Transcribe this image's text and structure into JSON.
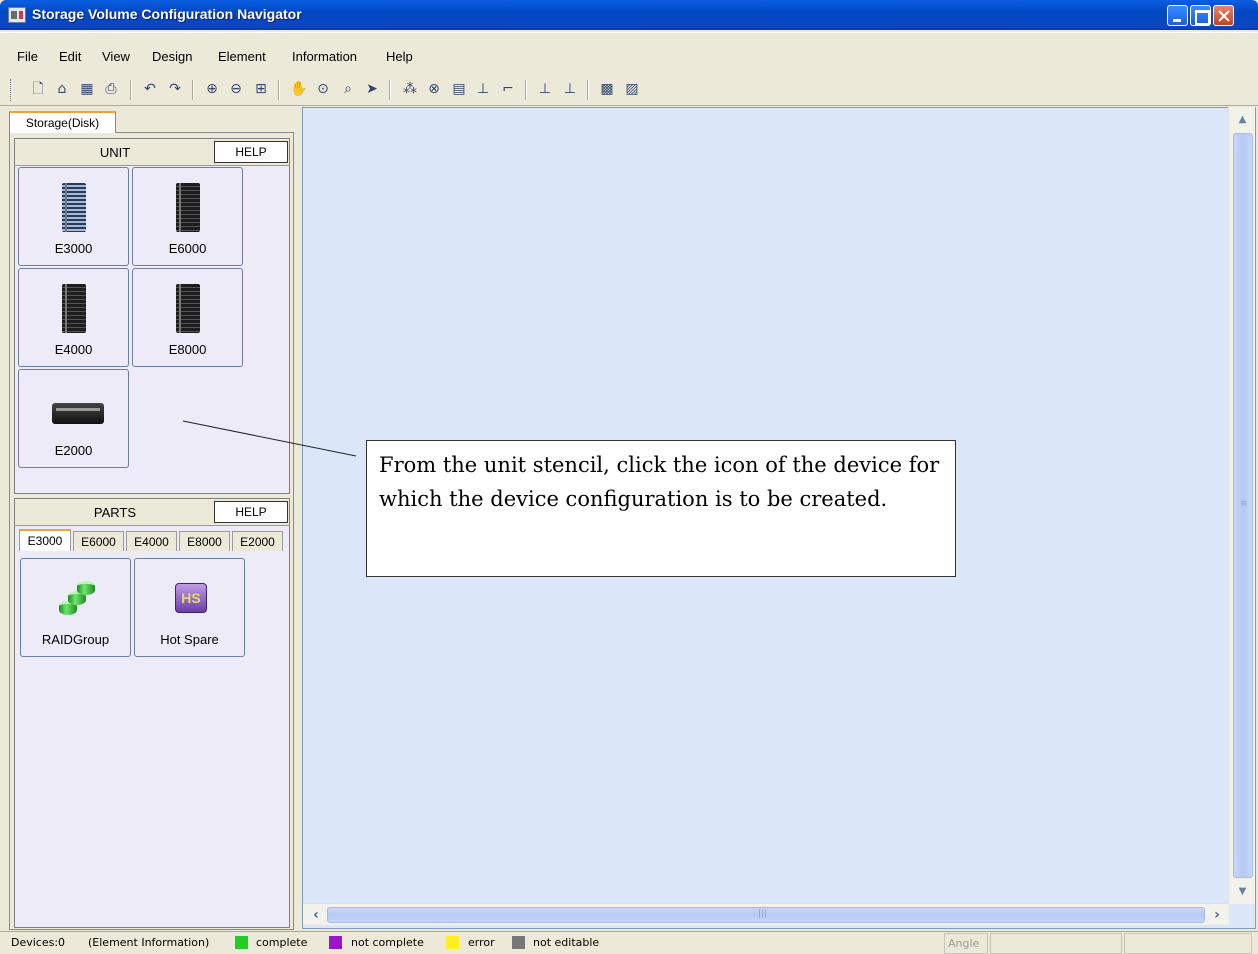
{
  "window": {
    "title": "Storage Volume Configuration Navigator"
  },
  "menu": [
    "File",
    "Edit",
    "View",
    "Design",
    "Element",
    "Information",
    "Help"
  ],
  "toolbar_icons": [
    "new-icon",
    "open-icon",
    "save-icon",
    "print-icon",
    "undo-icon",
    "redo-icon",
    "zoom-in-icon",
    "zoom-out-icon",
    "fit-icon",
    "pan-hand-icon",
    "zoom-area-icon",
    "find-icon",
    "select-pointer-icon",
    "layout-tree-icon",
    "connect-icon",
    "grid-icon",
    "hierarchy-icon",
    "route-icon",
    "align-left-icon",
    "align-right-icon",
    "group-icon",
    "ungroup-icon"
  ],
  "left_panel": {
    "tab": "Storage(Disk)",
    "unit": {
      "title": "UNIT",
      "help": "HELP",
      "items": [
        "E3000",
        "E6000",
        "E4000",
        "E8000",
        "E2000"
      ]
    },
    "parts": {
      "title": "PARTS",
      "help": "HELP",
      "tabs": [
        "E3000",
        "E6000",
        "E4000",
        "E8000",
        "E2000"
      ],
      "active_tab": "E3000",
      "items": [
        "RAIDGroup",
        "Hot Spare"
      ]
    }
  },
  "canvas": {
    "callout": "From the unit stencil, click the icon of the device for which the device configuration is to be created."
  },
  "statusbar": {
    "devices": "Devices:0",
    "element_info": "(Element Information)",
    "legend": [
      {
        "label": "complete",
        "color": "#22cc22"
      },
      {
        "label": "not complete",
        "color": "#9b16c9"
      },
      {
        "label": "error",
        "color": "#ffee22"
      },
      {
        "label": "not editable",
        "color": "#777777"
      }
    ],
    "angle": "Angle"
  }
}
